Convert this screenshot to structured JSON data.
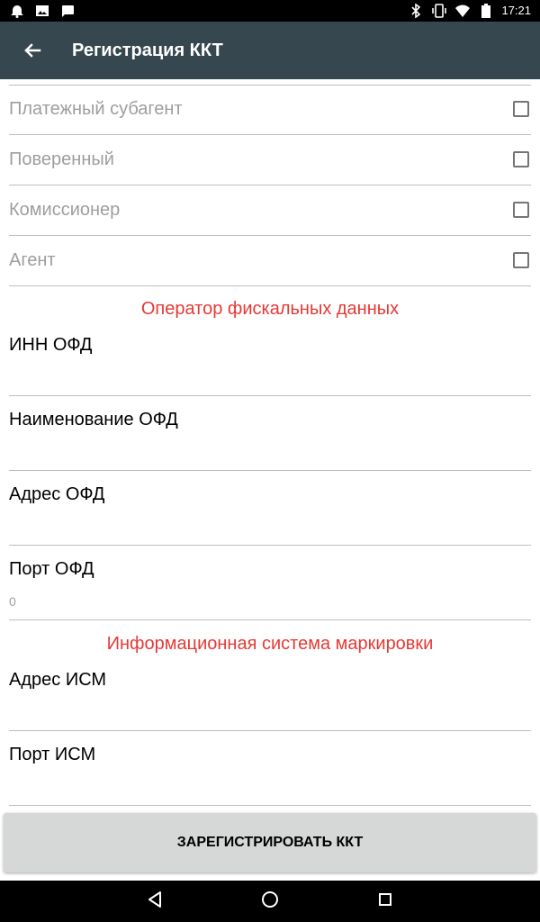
{
  "status_bar": {
    "time": "17:21",
    "left_icons": [
      "alarm-icon",
      "image-icon",
      "message-icon"
    ],
    "right_icons": [
      "bluetooth-icon",
      "vibrate-icon",
      "wifi-icon",
      "battery-icon"
    ]
  },
  "app_bar": {
    "title": "Регистрация ККТ",
    "back_icon": "arrow-back-icon",
    "background": "#37474f"
  },
  "checkbox_items": [
    {
      "label": "Платежный субагент",
      "checked": false
    },
    {
      "label": "Поверенный",
      "checked": false
    },
    {
      "label": "Комиссионер",
      "checked": false
    },
    {
      "label": "Агент",
      "checked": false
    }
  ],
  "sections": {
    "ofd": {
      "title": "Оператор фискальных данных",
      "fields": [
        {
          "label": "ИНН ОФД",
          "value": ""
        },
        {
          "label": "Наименование ОФД",
          "value": ""
        },
        {
          "label": "Адрес ОФД",
          "value": ""
        },
        {
          "label": "Порт ОФД",
          "value": "0"
        }
      ]
    },
    "ism": {
      "title": "Информационная система маркировки",
      "fields": [
        {
          "label": "Адрес ИСМ",
          "value": ""
        },
        {
          "label": "Порт ИСМ",
          "value": ""
        }
      ]
    }
  },
  "register_button": {
    "label": "ЗАРЕГИСТРИРОВАТЬ ККТ"
  },
  "nav_bar": {
    "icons": [
      "back-triangle-icon",
      "home-circle-icon",
      "recents-square-icon"
    ]
  },
  "colors": {
    "accent": "#e53935",
    "button": "#d6d7d7",
    "disabled_text": "#9e9e9e"
  }
}
